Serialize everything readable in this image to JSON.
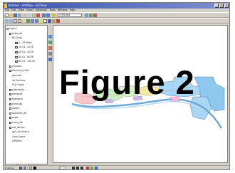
{
  "window": {
    "title": "Untitled - ArcMap - ArcView",
    "min_glyph": "_",
    "max_glyph": "□",
    "close_glyph": "x"
  },
  "menu": [
    "File",
    "Edit",
    "View",
    "Insert",
    "Selection",
    "Tools",
    "Window",
    "Help"
  ],
  "toolbar": {
    "scale_value": "1:350,000"
  },
  "toc": {
    "layers": [
      {
        "label": "Layers",
        "indent": 0,
        "type": "group"
      },
      {
        "label": "coast_db",
        "indent": 1,
        "type": "layer"
      },
      {
        "label": "BG_Data",
        "indent": 2,
        "type": "text"
      },
      {
        "label": "0 - 10 Miles",
        "indent": 3,
        "type": "legend",
        "color": "#e0e0e0"
      },
      {
        "label": "10.01 - 20 Mi",
        "indent": 3,
        "type": "legend",
        "color": "#c7e8ff"
      },
      {
        "label": "20.01 - 40 Mi",
        "indent": 3,
        "type": "legend",
        "color": "#9fd1f0"
      },
      {
        "label": "40.01 - 60 Mi",
        "indent": 3,
        "type": "legend",
        "color": "#ffd0d0"
      },
      {
        "label": "60.01 - 100 Mi",
        "indent": 3,
        "type": "legend",
        "color": "#c9f0c0"
      },
      {
        "label": "counties",
        "indent": 1,
        "type": "layer"
      },
      {
        "label": "Counties_2000",
        "indent": 1,
        "type": "layer"
      },
      {
        "label": "parishes",
        "indent": 2,
        "type": "text"
      },
      {
        "label": "LA Parishes",
        "indent": 2,
        "type": "text"
      },
      {
        "label": "Gulf Coast",
        "indent": 2,
        "type": "text"
      },
      {
        "label": "waterbody",
        "indent": 1,
        "type": "layer"
      },
      {
        "label": "wetlands",
        "indent": 1,
        "type": "layer"
      },
      {
        "label": "highways",
        "indent": 1,
        "type": "layer"
      },
      {
        "label": "cities_db",
        "indent": 1,
        "type": "layer"
      },
      {
        "label": "states",
        "indent": 1,
        "type": "layer"
      },
      {
        "label": "shoreline_db",
        "indent": 1,
        "type": "layer"
      },
      {
        "label": "roads",
        "indent": 1,
        "type": "layer"
      },
      {
        "label": "rivers_db",
        "indent": 1,
        "type": "layer"
      },
      {
        "label": "nat_db.shp",
        "indent": 1,
        "type": "layer"
      },
      {
        "label": "gulf_of_mexico",
        "indent": 2,
        "type": "text"
      },
      {
        "label": "Coast_zone",
        "indent": 2,
        "type": "text"
      },
      {
        "label": "Offshore",
        "indent": 2,
        "type": "text"
      }
    ],
    "tabs": [
      "Display",
      "Source"
    ]
  },
  "map": {
    "figure_label": "Figure 2"
  },
  "status": {
    "drawing_label": "Drawing"
  }
}
